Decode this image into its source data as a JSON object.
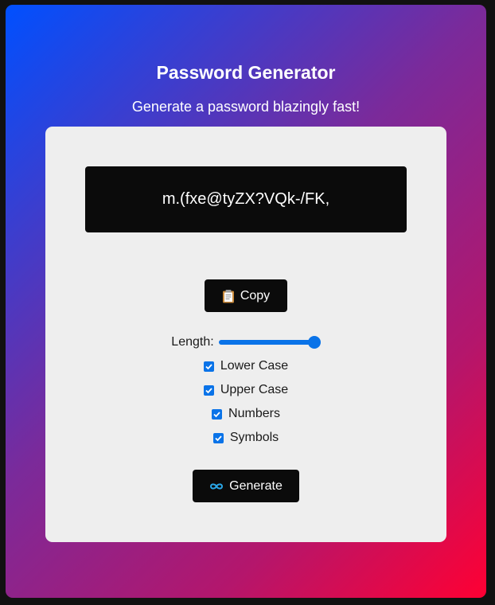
{
  "header": {
    "title": "Password Generator",
    "subtitle": "Generate a password blazingly fast!"
  },
  "password": {
    "value": "m.(fxe@tyZX?VQk-/FK,"
  },
  "copy_button": {
    "icon": "clipboard-icon",
    "label": "Copy"
  },
  "length": {
    "label": "Length:",
    "slider_fraction": 1.0
  },
  "options": [
    {
      "label": "Lower Case",
      "checked": true
    },
    {
      "label": "Upper Case",
      "checked": true
    },
    {
      "label": "Numbers",
      "checked": true
    },
    {
      "label": "Symbols",
      "checked": true
    }
  ],
  "generate_button": {
    "icon": "infinity-icon",
    "label": "Generate"
  },
  "colors": {
    "gradient_start": "#0050ff",
    "gradient_mid": "#7b2a9a",
    "gradient_end": "#ff0033",
    "card_bg": "#eeeeee",
    "dark": "#0b0b0b",
    "accent": "#0a73e8"
  }
}
